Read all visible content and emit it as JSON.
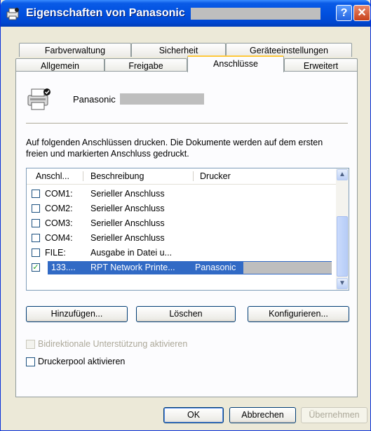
{
  "window": {
    "title": "Eigenschaften von Panasonic",
    "help_glyph": "?",
    "close_glyph": "✕"
  },
  "tabs": {
    "row1": [
      "Farbverwaltung",
      "Sicherheit",
      "Geräteeinstellungen"
    ],
    "row2": [
      "Allgemein",
      "Freigabe",
      "Anschlüsse",
      "Erweitert"
    ],
    "active": "Anschlüsse"
  },
  "printer": {
    "name": "Panasonic"
  },
  "description": "Auf folgenden Anschlüssen drucken. Die Dokumente werden auf dem ersten freien und markierten Anschluss gedruckt.",
  "port_list": {
    "headers": [
      "Anschl...",
      "Beschreibung",
      "Drucker"
    ],
    "rows": [
      {
        "port": "COM1:",
        "description": "Serieller Anschluss",
        "printer": "",
        "checked": false,
        "selected": false
      },
      {
        "port": "COM2:",
        "description": "Serieller Anschluss",
        "printer": "",
        "checked": false,
        "selected": false
      },
      {
        "port": "COM3:",
        "description": "Serieller Anschluss",
        "printer": "",
        "checked": false,
        "selected": false
      },
      {
        "port": "COM4:",
        "description": "Serieller Anschluss",
        "printer": "",
        "checked": false,
        "selected": false
      },
      {
        "port": "FILE:",
        "description": "Ausgabe in Datei u...",
        "printer": "",
        "checked": false,
        "selected": false
      },
      {
        "port": "133....",
        "description": "RPT Network Printe...",
        "printer": "Panasonic",
        "checked": true,
        "selected": true
      }
    ]
  },
  "port_buttons": {
    "add": "Hinzufügen...",
    "delete": "Löschen",
    "configure": "Konfigurieren..."
  },
  "options": {
    "bidirectional": {
      "label": "Bidirektionale Unterstützung aktivieren",
      "checked": false,
      "enabled": false
    },
    "pool": {
      "label": "Druckerpool aktivieren",
      "checked": false,
      "enabled": true
    }
  },
  "dialog_buttons": {
    "ok": "OK",
    "cancel": "Abbrechen",
    "apply": "Übernehmen"
  },
  "colors": {
    "titlebar": "#0050E0",
    "selection": "#316AC5",
    "dialog_bg": "#ECE9D8",
    "active_tab_accent": "#FFC83C"
  }
}
